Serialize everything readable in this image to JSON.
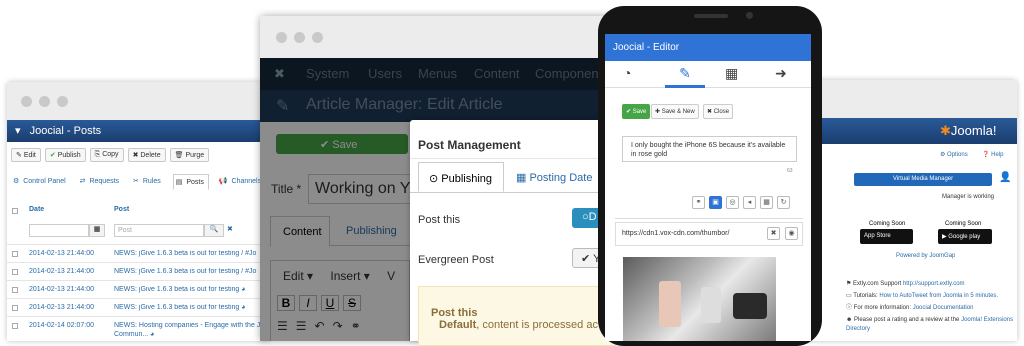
{
  "left": {
    "title": "Joocial - Posts",
    "buttons": [
      "Edit",
      "Publish",
      "Copy",
      "Delete",
      "Purge"
    ],
    "tabs": [
      "Control Panel",
      "Requests",
      "Rules",
      "Posts",
      "Channels"
    ],
    "col_date": "Date",
    "col_post": "Post",
    "post_placeholder": "Post",
    "rows": [
      {
        "date": "2014-02-13 21:44:00",
        "post": "NEWS: jGive 1.6.3 beta is out for testing / #Jo"
      },
      {
        "date": "2014-02-13 21:44:00",
        "post": "NEWS: jGive 1.6.3 beta is out for testing / #Jo"
      },
      {
        "date": "2014-02-13 21:44:00",
        "post": "NEWS: jGive 1.6.3 beta is out for testing"
      },
      {
        "date": "2014-02-13 21:44:00",
        "post": "NEWS: jGive 1.6.3 beta is out for testing"
      },
      {
        "date": "2014-02-14 02:07:00",
        "post": "NEWS: Hosting companies - Engage with the Jo",
        "post2": "Commun..."
      }
    ]
  },
  "middle": {
    "nav": [
      "System",
      "Users",
      "Menus",
      "Content",
      "Components"
    ],
    "page_title": "Article Manager: Edit Article",
    "save": "Save",
    "title_label": "Title *",
    "title_value": "Working on Y",
    "tabs": [
      "Content",
      "Publishing"
    ],
    "editor_menu": [
      "Edit",
      "Insert",
      "V"
    ],
    "fmt": [
      "B",
      "I",
      "U",
      "S"
    ]
  },
  "modal": {
    "title": "Post Management",
    "tab_publishing": "Publishing",
    "tab_posting": "Posting Date",
    "post_this": "Post this",
    "post_this_btn": "D",
    "evergreen": "Evergreen Post",
    "evergreen_btn": "Y",
    "alert_title": "Post this",
    "alert_bold": "Default",
    "alert_text": ", content is processed ac"
  },
  "phone": {
    "header": "Joocial - Editor",
    "save": "Save",
    "save_new": "Save & New",
    "close": "Close",
    "message": "I only bought the iPhone 6S because it's available in rose gold",
    "counter": "63",
    "url": "https://cdn1.vox-cdn.com/thumbor/",
    "accent": "#2f73d6"
  },
  "right": {
    "brand": "Joomla!",
    "options": "Options",
    "help": "Help",
    "vmm_btn": "Virtual Media Manager",
    "manager_status": "Manager is working",
    "coming_soon": "Coming Soon",
    "app_store": "App Store",
    "google_play": "Google play",
    "powered": "Powered by JoomGap",
    "support_label": "Extly.com Support",
    "support_link": "http://support.extly.com",
    "tutorials_label": "Tutorials:",
    "tutorials_link": "How to AutoTweet from Joomla in 5 minutes.",
    "more_label": "For more information:",
    "more_link": "Joocial Documentation",
    "rate": "Please post a rating and a review at the",
    "rate_link": "Joomla! Extensions Directory"
  }
}
